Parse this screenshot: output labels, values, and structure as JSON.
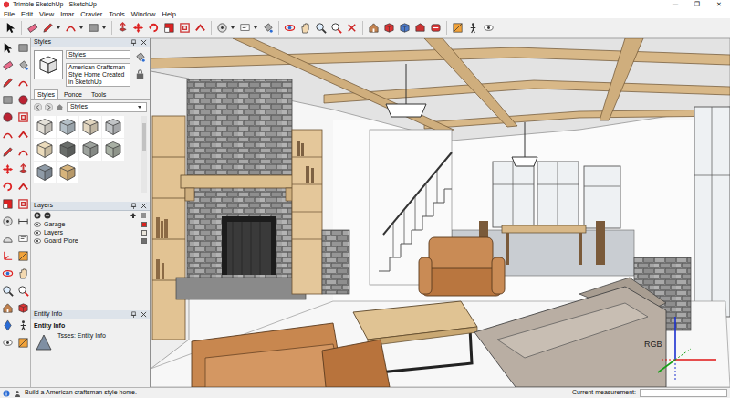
{
  "window": {
    "title": "Trimble SketchUp - SketchUp",
    "controls": [
      "—",
      "❐",
      "✕"
    ]
  },
  "menu": [
    "File",
    "Edit",
    "View",
    "Imar",
    "Cravier",
    "Tools",
    "Window",
    "Help"
  ],
  "styles_panel": {
    "title": "Styles",
    "name": "Styles",
    "description": "American Craftsman Style Home Created in SketchUp",
    "tabs": [
      {
        "label": "Styles",
        "selected": true
      },
      {
        "label": "Ponce",
        "selected": false
      },
      {
        "label": "Tools",
        "selected": false
      }
    ],
    "dropdown": "Styles",
    "thumbnails": [
      {
        "color": "#e4e0d8"
      },
      {
        "color": "#b4c0c8"
      },
      {
        "color": "#e3d7c0"
      },
      {
        "color": "#c2c5c7"
      },
      {
        "color": "#ecdcbc"
      },
      {
        "color": "#6a6e6b"
      },
      {
        "color": "#9da29d"
      },
      {
        "color": "#a8b0a4"
      },
      {
        "color": "#8f9ba7"
      },
      {
        "color": "#d7b47c"
      }
    ]
  },
  "layers_panel": {
    "title": "Layers",
    "items": [
      {
        "name": "Garage",
        "visible": true,
        "color": "#d9231e"
      },
      {
        "name": "Layers",
        "visible": true,
        "color": "#e9e4da"
      },
      {
        "name": "Goard Plore",
        "visible": true,
        "color": "#6f6f6f"
      }
    ]
  },
  "entity_panel": {
    "title": "Entity Info",
    "heading": "Entity Info",
    "info": "Tsses: Entity Info"
  },
  "viewport": {
    "axes_label": "RGB"
  },
  "status_bar": {
    "hint": "Build a American craftsman style home.",
    "measurement_label": "Current measurement:"
  }
}
